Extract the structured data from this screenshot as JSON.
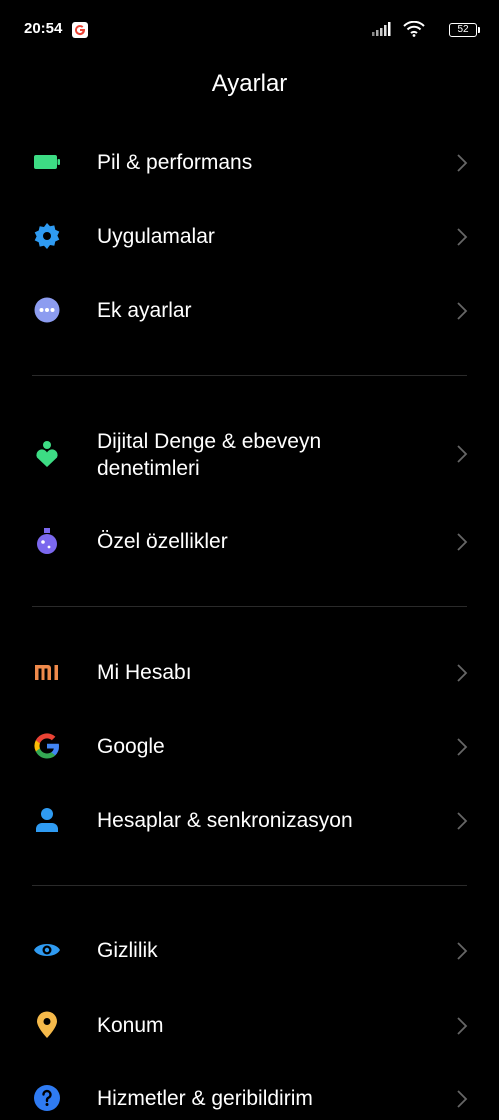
{
  "status_bar": {
    "time": "20:54",
    "battery": "52",
    "icons": [
      "google-icon",
      "signal-icon",
      "wifi-icon",
      "battery-icon"
    ]
  },
  "header": {
    "title": "Ayarlar"
  },
  "sections": [
    {
      "items": [
        {
          "label": "Pil & performans",
          "icon": "battery-icon",
          "color": "#3ddc84"
        },
        {
          "label": "Uygulamalar",
          "icon": "gear-icon",
          "color": "#2f9bf2"
        },
        {
          "label": "Ek ayarlar",
          "icon": "more-dots-icon",
          "color": "#8c9cf0"
        }
      ]
    },
    {
      "items": [
        {
          "label_line1": "Dijital Denge & ebeveyn",
          "label_line2": "denetimleri",
          "icon": "digital-wellbeing-icon",
          "color": "#3ddc84"
        },
        {
          "label": "Özel özellikler",
          "icon": "flask-icon",
          "color": "#7b68ee"
        }
      ]
    },
    {
      "items": [
        {
          "label": "Mi Hesabı",
          "icon": "mi-logo-icon",
          "color": "#f08a4b"
        },
        {
          "label": "Google",
          "icon": "google-logo-icon",
          "color": "#4285f4"
        },
        {
          "label": "Hesaplar & senkronizasyon",
          "icon": "person-icon",
          "color": "#2f9bf2"
        }
      ]
    },
    {
      "items": [
        {
          "label": "Gizlilik",
          "icon": "eye-icon",
          "color": "#2f9bf2"
        },
        {
          "label": "Konum",
          "icon": "location-pin-icon",
          "color": "#f5b94a"
        },
        {
          "label": "Hizmetler & geribildirim",
          "icon": "help-icon",
          "color": "#2f7bf2"
        }
      ]
    }
  ]
}
